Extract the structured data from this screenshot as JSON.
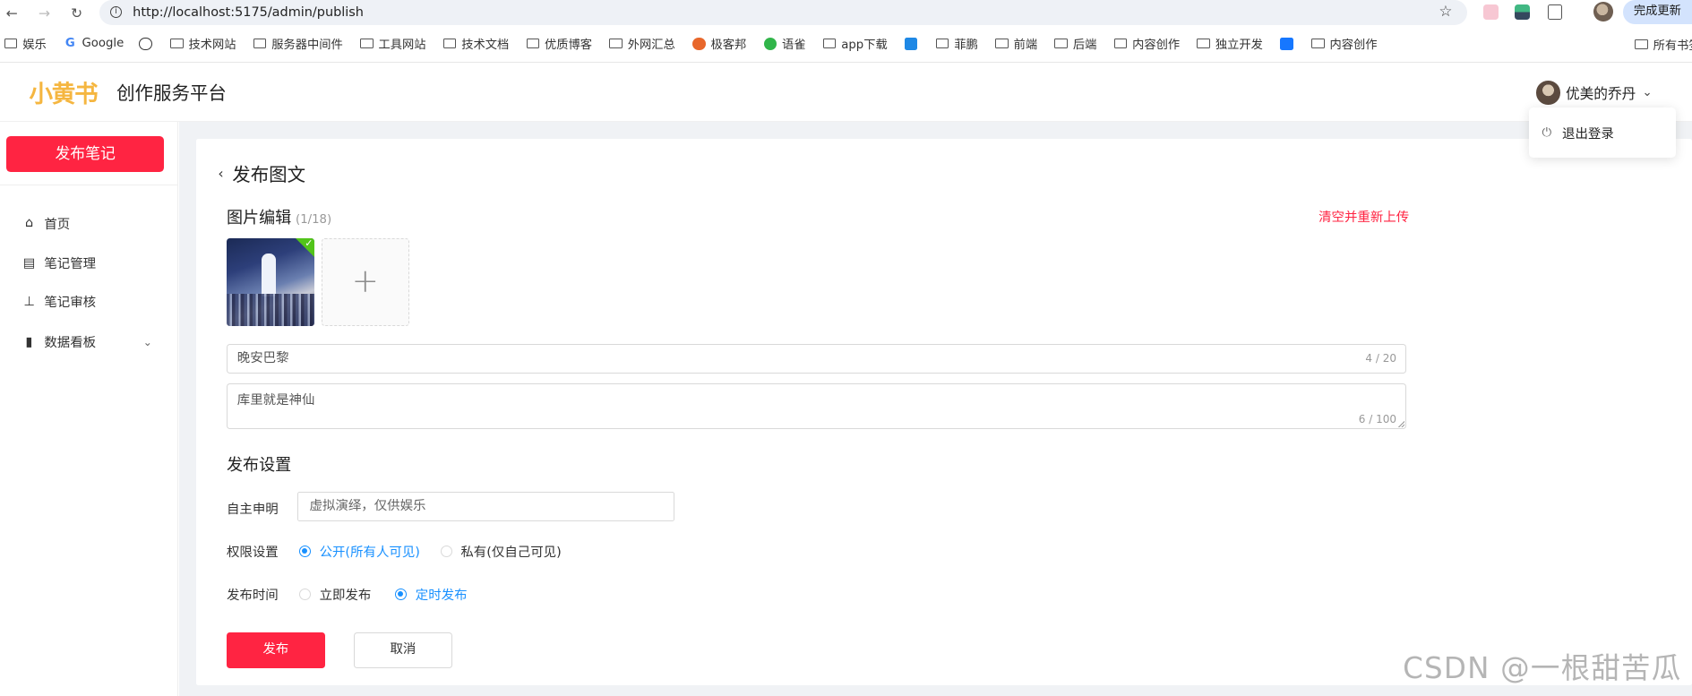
{
  "browser": {
    "url": "http://localhost:5175/admin/publish",
    "update_button": "完成更新",
    "bookmarks": [
      "娱乐",
      "Google",
      "技术网站",
      "服务器中间件",
      "工具网站",
      "技术文档",
      "优质博客",
      "外网汇总",
      "极客邦",
      "语雀",
      "app下载",
      "菲鹏",
      "前端",
      "后端",
      "内容创作",
      "独立开发",
      "内容创作"
    ],
    "bookmarks_right": "所有书签"
  },
  "header": {
    "logo": "小黄书",
    "platform": "创作服务平台",
    "username": "优美的乔丹",
    "dropdown_logout": "退出登录"
  },
  "sidebar": {
    "publish_button": "发布笔记",
    "items": [
      {
        "label": "首页",
        "icon": "home-icon"
      },
      {
        "label": "笔记管理",
        "icon": "document-icon"
      },
      {
        "label": "笔记审核",
        "icon": "stamp-icon"
      },
      {
        "label": "数据看板",
        "icon": "bar-chart-icon"
      }
    ]
  },
  "main": {
    "page_title": "发布图文",
    "image_section": {
      "title": "图片编辑",
      "count": "(1/18)",
      "clear_link": "清空并重新上传"
    },
    "title_input": {
      "value": "晚安巴黎",
      "counter": "4 / 20"
    },
    "desc_input": {
      "value": "库里就是神仙",
      "counter": "6 / 100"
    },
    "settings_title": "发布设置",
    "statement": {
      "label": "自主申明",
      "placeholder": "虚拟演绎，仅供娱乐"
    },
    "permission": {
      "label": "权限设置",
      "options": [
        "公开(所有人可见)",
        "私有(仅自己可见)"
      ],
      "selected": "公开(所有人可见)"
    },
    "publish_time": {
      "label": "发布时间",
      "options": [
        "立即发布",
        "定时发布"
      ],
      "selected": "定时发布"
    },
    "publish_button": "发布",
    "cancel_button": "取消"
  },
  "watermark": "CSDN @一根甜苦瓜",
  "colors": {
    "accent": "#ff2442",
    "radio_active": "#1890ff",
    "content_bg": "#f0f2f5",
    "logo": "#f5b640"
  }
}
